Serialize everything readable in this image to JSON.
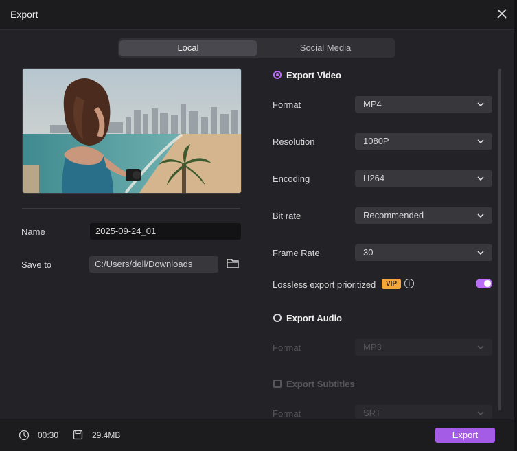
{
  "window": {
    "title": "Export"
  },
  "tabs": [
    {
      "label": "Local",
      "selected": true
    },
    {
      "label": "Social Media",
      "selected": false
    }
  ],
  "left": {
    "name_label": "Name",
    "name_value": "2025-09-24_01",
    "save_label": "Save to",
    "save_path": "C:/Users/dell/Downloads"
  },
  "export_video": {
    "label": "Export Video",
    "selected": true,
    "rows": [
      {
        "label": "Format",
        "value": "MP4"
      },
      {
        "label": "Resolution",
        "value": "1080P"
      },
      {
        "label": "Encoding",
        "value": "H264"
      },
      {
        "label": "Bit rate",
        "value": "Recommended"
      },
      {
        "label": "Frame Rate",
        "value": "30"
      }
    ],
    "lossless_label": "Lossless export prioritized",
    "vip_badge": "VIP",
    "info_glyph": "i",
    "lossless_on": true
  },
  "export_audio": {
    "label": "Export Audio",
    "selected": false,
    "format_label": "Format",
    "format_value": "MP3"
  },
  "export_subtitles": {
    "label": "Export Subtitles",
    "checked": false,
    "format_label": "Format",
    "format_value": "SRT"
  },
  "footer": {
    "duration": "00:30",
    "size": "29.4MB",
    "export_label": "Export"
  },
  "colors": {
    "accent": "#b86ff5",
    "button": "#a45be6",
    "vip": "#f5a63a"
  }
}
